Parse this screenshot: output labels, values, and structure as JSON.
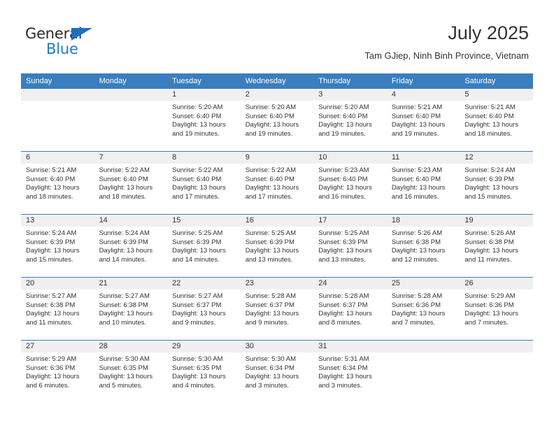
{
  "brand": {
    "general": "General",
    "blue": "Blue",
    "triangle_color": "#1f6fc0",
    "blue_color": "#1f7cc4"
  },
  "header": {
    "title": "July 2025",
    "subtitle": "Tam GJiep, Ninh Binh Province, Vietnam"
  },
  "theme": {
    "header_bg": "#3a7ebf",
    "daynum_bg": "#f0f0f0",
    "text": "#333333"
  },
  "weekday_headers": [
    "Sunday",
    "Monday",
    "Tuesday",
    "Wednesday",
    "Thursday",
    "Friday",
    "Saturday"
  ],
  "weeks": [
    [
      {
        "day": "",
        "sunrise": "",
        "sunset": "",
        "daylight1": "",
        "daylight2": ""
      },
      {
        "day": "",
        "sunrise": "",
        "sunset": "",
        "daylight1": "",
        "daylight2": ""
      },
      {
        "day": "1",
        "sunrise": "Sunrise: 5:20 AM",
        "sunset": "Sunset: 6:40 PM",
        "daylight1": "Daylight: 13 hours",
        "daylight2": "and 19 minutes."
      },
      {
        "day": "2",
        "sunrise": "Sunrise: 5:20 AM",
        "sunset": "Sunset: 6:40 PM",
        "daylight1": "Daylight: 13 hours",
        "daylight2": "and 19 minutes."
      },
      {
        "day": "3",
        "sunrise": "Sunrise: 5:20 AM",
        "sunset": "Sunset: 6:40 PM",
        "daylight1": "Daylight: 13 hours",
        "daylight2": "and 19 minutes."
      },
      {
        "day": "4",
        "sunrise": "Sunrise: 5:21 AM",
        "sunset": "Sunset: 6:40 PM",
        "daylight1": "Daylight: 13 hours",
        "daylight2": "and 19 minutes."
      },
      {
        "day": "5",
        "sunrise": "Sunrise: 5:21 AM",
        "sunset": "Sunset: 6:40 PM",
        "daylight1": "Daylight: 13 hours",
        "daylight2": "and 18 minutes."
      }
    ],
    [
      {
        "day": "6",
        "sunrise": "Sunrise: 5:21 AM",
        "sunset": "Sunset: 6:40 PM",
        "daylight1": "Daylight: 13 hours",
        "daylight2": "and 18 minutes."
      },
      {
        "day": "7",
        "sunrise": "Sunrise: 5:22 AM",
        "sunset": "Sunset: 6:40 PM",
        "daylight1": "Daylight: 13 hours",
        "daylight2": "and 18 minutes."
      },
      {
        "day": "8",
        "sunrise": "Sunrise: 5:22 AM",
        "sunset": "Sunset: 6:40 PM",
        "daylight1": "Daylight: 13 hours",
        "daylight2": "and 17 minutes."
      },
      {
        "day": "9",
        "sunrise": "Sunrise: 5:22 AM",
        "sunset": "Sunset: 6:40 PM",
        "daylight1": "Daylight: 13 hours",
        "daylight2": "and 17 minutes."
      },
      {
        "day": "10",
        "sunrise": "Sunrise: 5:23 AM",
        "sunset": "Sunset: 6:40 PM",
        "daylight1": "Daylight: 13 hours",
        "daylight2": "and 16 minutes."
      },
      {
        "day": "11",
        "sunrise": "Sunrise: 5:23 AM",
        "sunset": "Sunset: 6:40 PM",
        "daylight1": "Daylight: 13 hours",
        "daylight2": "and 16 minutes."
      },
      {
        "day": "12",
        "sunrise": "Sunrise: 5:24 AM",
        "sunset": "Sunset: 6:39 PM",
        "daylight1": "Daylight: 13 hours",
        "daylight2": "and 15 minutes."
      }
    ],
    [
      {
        "day": "13",
        "sunrise": "Sunrise: 5:24 AM",
        "sunset": "Sunset: 6:39 PM",
        "daylight1": "Daylight: 13 hours",
        "daylight2": "and 15 minutes."
      },
      {
        "day": "14",
        "sunrise": "Sunrise: 5:24 AM",
        "sunset": "Sunset: 6:39 PM",
        "daylight1": "Daylight: 13 hours",
        "daylight2": "and 14 minutes."
      },
      {
        "day": "15",
        "sunrise": "Sunrise: 5:25 AM",
        "sunset": "Sunset: 6:39 PM",
        "daylight1": "Daylight: 13 hours",
        "daylight2": "and 14 minutes."
      },
      {
        "day": "16",
        "sunrise": "Sunrise: 5:25 AM",
        "sunset": "Sunset: 6:39 PM",
        "daylight1": "Daylight: 13 hours",
        "daylight2": "and 13 minutes."
      },
      {
        "day": "17",
        "sunrise": "Sunrise: 5:25 AM",
        "sunset": "Sunset: 6:39 PM",
        "daylight1": "Daylight: 13 hours",
        "daylight2": "and 13 minutes."
      },
      {
        "day": "18",
        "sunrise": "Sunrise: 5:26 AM",
        "sunset": "Sunset: 6:38 PM",
        "daylight1": "Daylight: 13 hours",
        "daylight2": "and 12 minutes."
      },
      {
        "day": "19",
        "sunrise": "Sunrise: 5:26 AM",
        "sunset": "Sunset: 6:38 PM",
        "daylight1": "Daylight: 13 hours",
        "daylight2": "and 11 minutes."
      }
    ],
    [
      {
        "day": "20",
        "sunrise": "Sunrise: 5:27 AM",
        "sunset": "Sunset: 6:38 PM",
        "daylight1": "Daylight: 13 hours",
        "daylight2": "and 11 minutes."
      },
      {
        "day": "21",
        "sunrise": "Sunrise: 5:27 AM",
        "sunset": "Sunset: 6:38 PM",
        "daylight1": "Daylight: 13 hours",
        "daylight2": "and 10 minutes."
      },
      {
        "day": "22",
        "sunrise": "Sunrise: 5:27 AM",
        "sunset": "Sunset: 6:37 PM",
        "daylight1": "Daylight: 13 hours",
        "daylight2": "and 9 minutes."
      },
      {
        "day": "23",
        "sunrise": "Sunrise: 5:28 AM",
        "sunset": "Sunset: 6:37 PM",
        "daylight1": "Daylight: 13 hours",
        "daylight2": "and 9 minutes."
      },
      {
        "day": "24",
        "sunrise": "Sunrise: 5:28 AM",
        "sunset": "Sunset: 6:37 PM",
        "daylight1": "Daylight: 13 hours",
        "daylight2": "and 8 minutes."
      },
      {
        "day": "25",
        "sunrise": "Sunrise: 5:28 AM",
        "sunset": "Sunset: 6:36 PM",
        "daylight1": "Daylight: 13 hours",
        "daylight2": "and 7 minutes."
      },
      {
        "day": "26",
        "sunrise": "Sunrise: 5:29 AM",
        "sunset": "Sunset: 6:36 PM",
        "daylight1": "Daylight: 13 hours",
        "daylight2": "and 7 minutes."
      }
    ],
    [
      {
        "day": "27",
        "sunrise": "Sunrise: 5:29 AM",
        "sunset": "Sunset: 6:36 PM",
        "daylight1": "Daylight: 13 hours",
        "daylight2": "and 6 minutes."
      },
      {
        "day": "28",
        "sunrise": "Sunrise: 5:30 AM",
        "sunset": "Sunset: 6:35 PM",
        "daylight1": "Daylight: 13 hours",
        "daylight2": "and 5 minutes."
      },
      {
        "day": "29",
        "sunrise": "Sunrise: 5:30 AM",
        "sunset": "Sunset: 6:35 PM",
        "daylight1": "Daylight: 13 hours",
        "daylight2": "and 4 minutes."
      },
      {
        "day": "30",
        "sunrise": "Sunrise: 5:30 AM",
        "sunset": "Sunset: 6:34 PM",
        "daylight1": "Daylight: 13 hours",
        "daylight2": "and 3 minutes."
      },
      {
        "day": "31",
        "sunrise": "Sunrise: 5:31 AM",
        "sunset": "Sunset: 6:34 PM",
        "daylight1": "Daylight: 13 hours",
        "daylight2": "and 3 minutes."
      },
      {
        "day": "",
        "sunrise": "",
        "sunset": "",
        "daylight1": "",
        "daylight2": ""
      },
      {
        "day": "",
        "sunrise": "",
        "sunset": "",
        "daylight1": "",
        "daylight2": ""
      }
    ]
  ]
}
